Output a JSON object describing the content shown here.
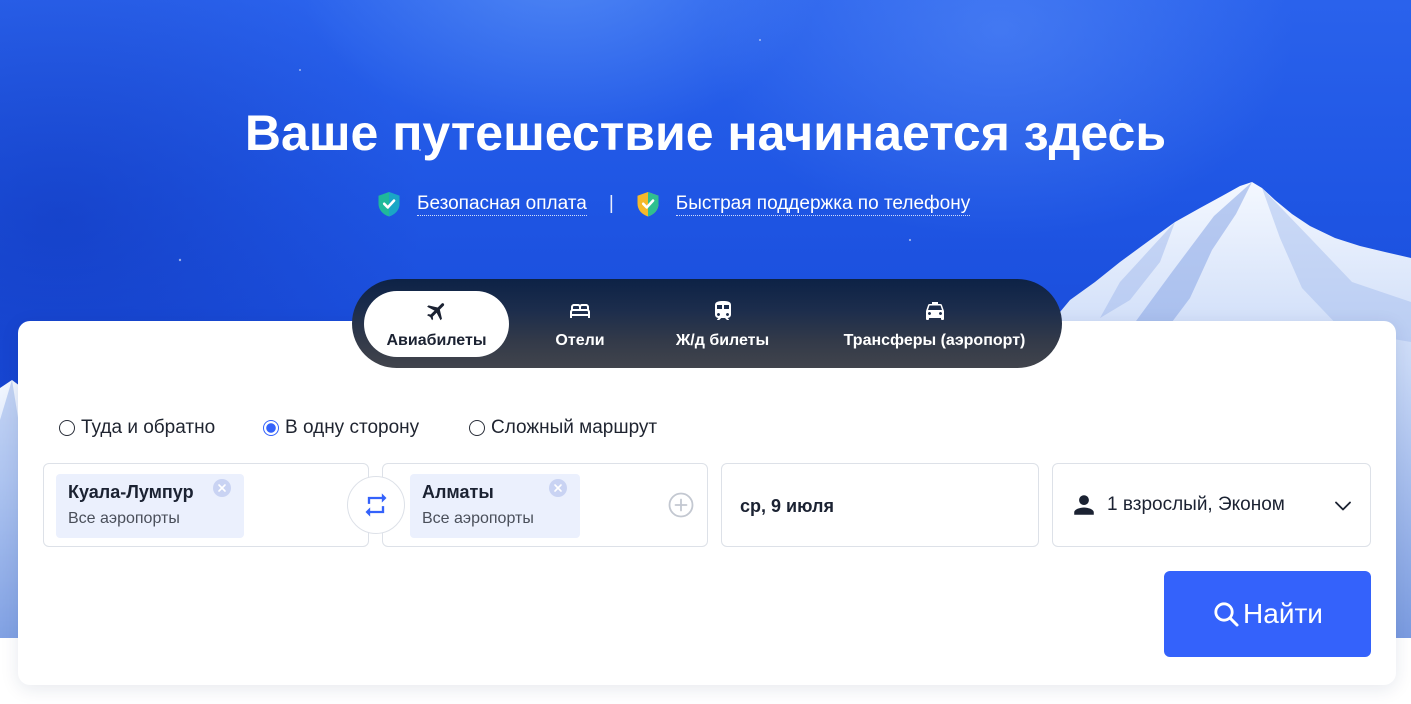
{
  "hero": {
    "title": "Ваше путешествие начинается здесь",
    "features": [
      {
        "icon": "shield-check-icon",
        "label": "Безопасная оплата"
      },
      {
        "icon": "support-shield-icon",
        "label": "Быстрая поддержка по телефону"
      }
    ],
    "separator": "|"
  },
  "tabs": [
    {
      "icon": "plane-icon",
      "label": "Авиабилеты",
      "active": true
    },
    {
      "icon": "bed-icon",
      "label": "Отели",
      "active": false
    },
    {
      "icon": "train-icon",
      "label": "Ж/д билеты",
      "active": false
    },
    {
      "icon": "taxi-icon",
      "label": "Трансферы (аэропорт)",
      "active": false
    }
  ],
  "trip_types": [
    {
      "label": "Туда и обратно",
      "selected": false
    },
    {
      "label": "В одну сторону",
      "selected": true
    },
    {
      "label": "Сложный маршрут",
      "selected": false
    }
  ],
  "search_form": {
    "from": {
      "city": "Куала-Лумпур",
      "airports": "Все аэропорты",
      "clear_icon": "clear-icon"
    },
    "swap_icon": "swap-icon",
    "to": {
      "city": "Алматы",
      "airports": "Все аэропорты",
      "clear_icon": "clear-icon",
      "add_icon": "plus-circle-icon"
    },
    "date": "ср, 9 июля",
    "passengers": {
      "icon": "person-icon",
      "value": "1 взрослый, Эконом",
      "dropdown_icon": "chevron-down-icon"
    },
    "submit": {
      "icon": "search-icon",
      "label": "Найти"
    }
  },
  "colors": {
    "accent": "#3462fb",
    "hero_blue": "#1c52e2",
    "tab_bar": "#1d2c48",
    "chip_bg": "#ebf0fd",
    "text_dark": "#1b2232",
    "feature_icon_primary": "#1fb99b",
    "feature_icon_secondary": "#f5b92a"
  }
}
